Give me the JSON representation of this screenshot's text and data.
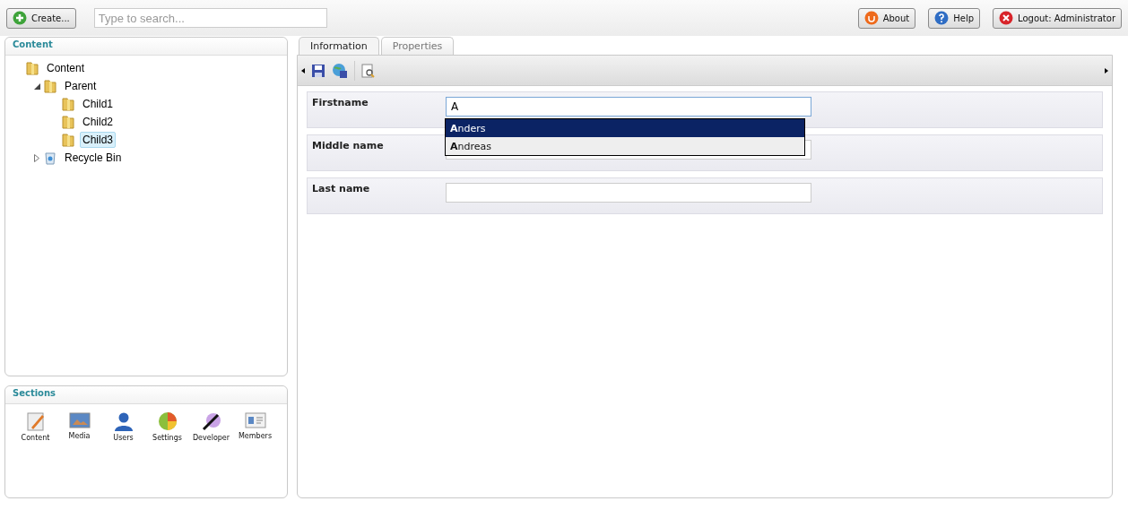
{
  "header": {
    "create_button": "Create...",
    "search": {
      "placeholder": "Type to search..."
    },
    "buttons": [
      {
        "kind": "about",
        "label": "About"
      },
      {
        "kind": "help",
        "label": "Help"
      },
      {
        "kind": "logout",
        "label": "Logout: Administrator"
      }
    ]
  },
  "content_panel": {
    "title": "Content",
    "tree": [
      {
        "label": "Content",
        "kind": "folder",
        "selected": false,
        "children": [
          {
            "label": "Parent",
            "kind": "folder",
            "expanded": true,
            "selected": false,
            "children": [
              {
                "label": "Child1",
                "kind": "folder",
                "selected": false
              },
              {
                "label": "Child2",
                "kind": "folder",
                "selected": false
              },
              {
                "label": "Child3",
                "kind": "folder",
                "selected": true
              }
            ]
          },
          {
            "label": "Recycle Bin",
            "kind": "bin",
            "expanded": false,
            "selected": false
          }
        ]
      }
    ]
  },
  "sections": {
    "title": "Sections",
    "items": [
      {
        "kind": "content",
        "label": "Content"
      },
      {
        "kind": "media",
        "label": "Media"
      },
      {
        "kind": "users",
        "label": "Users"
      },
      {
        "kind": "settings",
        "label": "Settings"
      },
      {
        "kind": "developer",
        "label": "Developer"
      },
      {
        "kind": "members",
        "label": "Members"
      }
    ]
  },
  "tabs": [
    {
      "label": "Information",
      "selected": true
    },
    {
      "label": "Properties",
      "selected": false
    }
  ],
  "fields": [
    {
      "label": "Firstname",
      "value": "A",
      "focused": true
    },
    {
      "label": "Middle name",
      "focused": false
    },
    {
      "label": "Last name",
      "focused": false
    }
  ],
  "autocomplete": [
    {
      "text": "**A**nders",
      "selected": true
    },
    {
      "text": "**A**ndreas",
      "selected": false
    }
  ]
}
